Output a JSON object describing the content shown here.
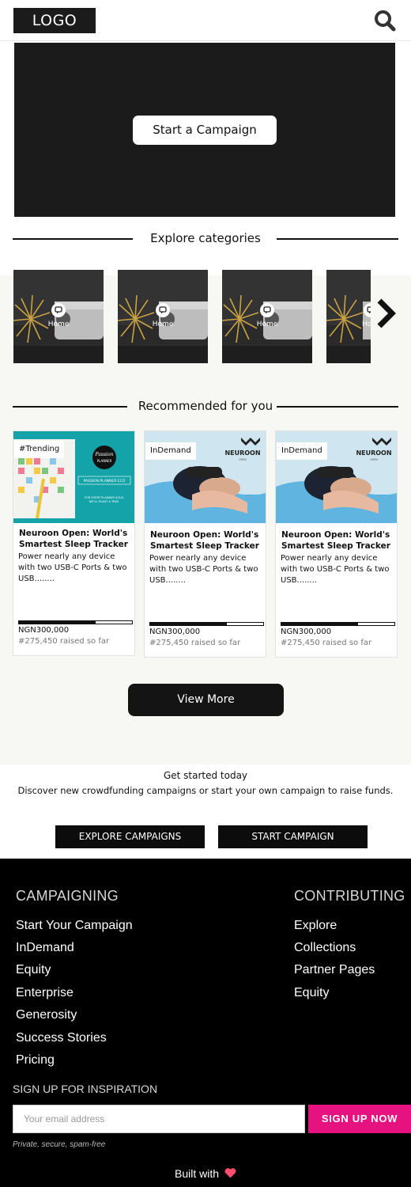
{
  "header": {
    "logo_text": "LOGO",
    "search_icon": "search-icon"
  },
  "hero": {
    "button_label": "Start a Campaign"
  },
  "categories": {
    "heading": "Explore categories",
    "items": [
      {
        "label": "Home",
        "icon": "chat-bubble-icon"
      },
      {
        "label": "Home",
        "icon": "chat-bubble-icon"
      },
      {
        "label": "Home",
        "icon": "chat-bubble-icon"
      },
      {
        "label": "Ho",
        "icon": "chat-bubble-icon"
      }
    ],
    "next_icon": "chevron-right-icon"
  },
  "recommended": {
    "heading": "Recommended for you",
    "cards": [
      {
        "tag": "#Trending",
        "image_text": [
          "Passion",
          "PLANNER",
          "PASSION PLANNER ECO",
          "FOR EVERY PLANNER SOLD,",
          "WE'LL PLANT A TREE."
        ],
        "title": "Neuroon Open: World's Smartest Sleep Tracker",
        "description": "Power nearly any device with two USB-C Ports & two USB........",
        "progress": 0.68,
        "goal": "NGN300,000",
        "raised": "#275,450 raised so far"
      },
      {
        "tag": "InDemand",
        "image_text": [
          "NEUROON",
          "OPEN"
        ],
        "title": "Neuroon Open: World's Smartest Sleep Tracker",
        "description": "Power nearly any device with two USB-C Ports & two USB........",
        "progress": 0.68,
        "goal": "NGN300,000",
        "raised": "#275,450 raised so far"
      },
      {
        "tag": "InDemand",
        "image_text": [
          "NEUROON",
          "OPEN"
        ],
        "title": "Neuroon Open: World's Smartest Sleep Tracker",
        "description": "Power nearly any device with two USB-C Ports & two USB........",
        "progress": 0.68,
        "goal": "NGN300,000",
        "raised": "#275,450 raised so far"
      }
    ],
    "view_more_label": "View More"
  },
  "get_started": {
    "title": "Get started today",
    "subtitle": "Discover new crowdfunding campaigns or start your own campaign to raise funds.",
    "explore_label": "EXPLORE CAMPAIGNS",
    "start_label": "START CAMPAIGN"
  },
  "footer": {
    "campaigning": {
      "heading": "CAMPAIGNING",
      "links": [
        "Start Your Campaign",
        "InDemand",
        "Equity",
        "Enterprise",
        "Generosity",
        "Success Stories",
        "Pricing"
      ]
    },
    "contributing": {
      "heading": "CONTRIBUTING",
      "links": [
        "Explore",
        "Collections",
        "Partner Pages",
        "Equity"
      ]
    },
    "signup": {
      "heading": "SIGN UP FOR INSPIRATION",
      "placeholder": "Your email address",
      "button_label": "SIGN UP NOW",
      "privacy": "Private, secure, spam-free"
    },
    "built_with": "Built with",
    "heart_icon": "heart-icon",
    "heart_color": "#ff4d6d"
  },
  "colors": {
    "accent_pink": "#e5127f",
    "dark": "#1b1b1c",
    "band_bg": "#f7f7f3"
  }
}
